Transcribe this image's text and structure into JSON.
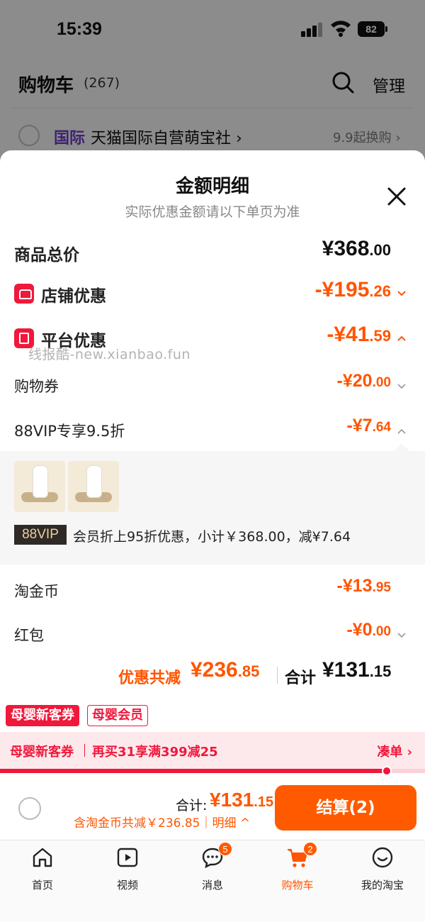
{
  "status_bar": {
    "time": "15:39",
    "battery": "82"
  },
  "header": {
    "title": "购物车",
    "count": "(267)",
    "manage_label": "管理"
  },
  "store_row": {
    "tag": "国际",
    "name": "天猫国际自营萌宝社 ›",
    "promo": "9.9起换购 ›"
  },
  "sheet": {
    "title": "金额明细",
    "subtitle": "实际优惠金额请以下单页为准",
    "rows": {
      "total": {
        "label": "商品总价",
        "amount_int": "¥368",
        "amount_dec": ".00"
      },
      "store_discount": {
        "label": "店铺优惠",
        "amount_int": "-¥195",
        "amount_dec": ".26"
      },
      "platform_discount": {
        "label": "平台优惠",
        "amount_int": "-¥41",
        "amount_dec": ".59"
      },
      "coupon": {
        "label": "购物券",
        "amount_int": "-¥20",
        "amount_dec": ".00"
      },
      "vip": {
        "label": "88VIP专享9.5折",
        "amount_int": "-¥7",
        "amount_dec": ".64"
      },
      "coins": {
        "label": "淘金币",
        "amount_int": "-¥13",
        "amount_dec": ".95"
      },
      "red_packet": {
        "label": "红包",
        "amount_int": "-¥0",
        "amount_dec": ".00"
      }
    },
    "watermark": "线报酷-new.xianbao.fun",
    "vip_panel": {
      "badge": "88VIP",
      "text": "会员折上95折优惠，小计￥368.00，减¥7.64"
    },
    "summary": {
      "discount_label": "优惠共减",
      "discount_int": "¥236",
      "discount_dec": ".85",
      "total_label": "合计",
      "total_int": "¥131",
      "total_dec": ".15"
    }
  },
  "tags": {
    "coupon": "母婴新客券",
    "member": "母婴会员"
  },
  "promo_bar": {
    "left": "母婴新客券",
    "middle": "再买31享满399减25",
    "link": "凑单 ›",
    "progress": 0.91
  },
  "checkout": {
    "total_label": "合计:",
    "total_int": "¥131",
    "total_dec": ".15",
    "note": "含淘金币共减￥236.85｜明细 ^",
    "button_label": "结算(2)"
  },
  "tabbar": {
    "items": [
      {
        "label": "首页",
        "icon": "home-icon"
      },
      {
        "label": "视频",
        "icon": "video-icon"
      },
      {
        "label": "消息",
        "icon": "message-icon",
        "badge": "5"
      },
      {
        "label": "购物车",
        "icon": "cart-icon",
        "badge": "2",
        "active": true
      },
      {
        "label": "我的淘宝",
        "icon": "profile-icon"
      }
    ]
  },
  "colors": {
    "accent": "#ff5500",
    "red": "#f0183b",
    "button": "#ff5a00"
  }
}
